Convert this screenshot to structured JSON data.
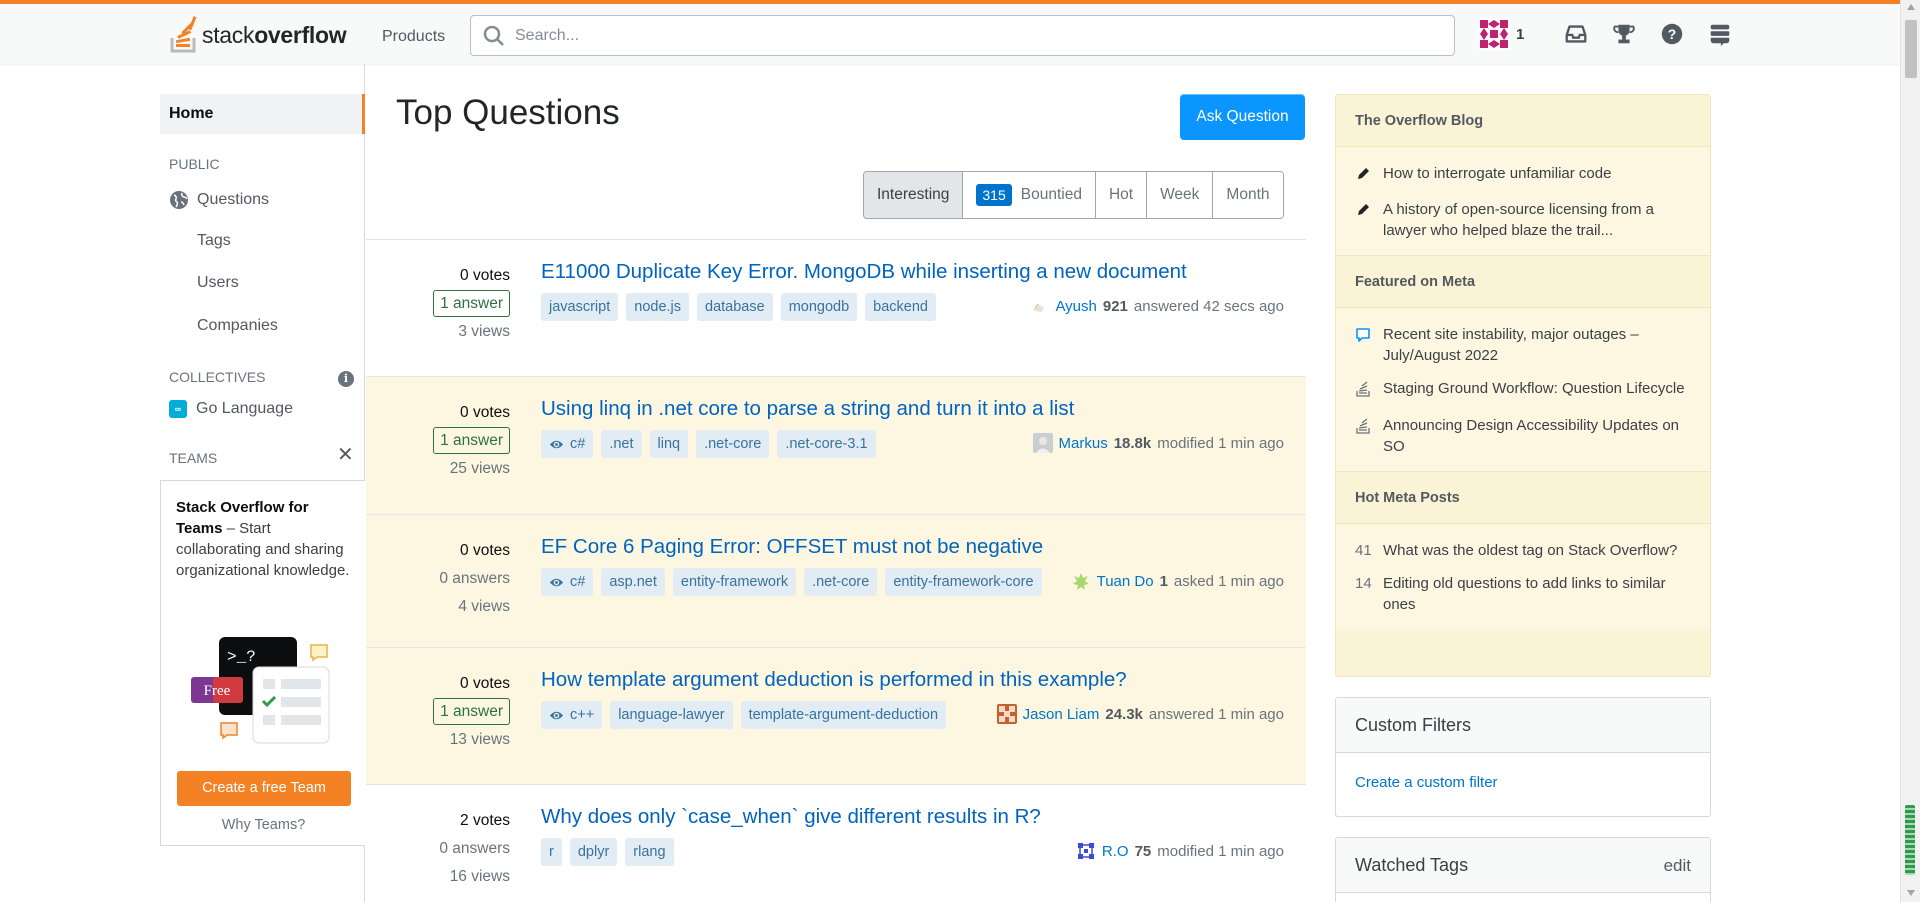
{
  "header": {
    "logo_text_light": "stack",
    "logo_text_bold": "overflow",
    "products_label": "Products",
    "search_placeholder": "Search...",
    "reputation": "1",
    "icons": [
      "inbox-icon",
      "achievements-icon",
      "help-icon",
      "site-switcher-icon"
    ]
  },
  "leftnav": {
    "home": "Home",
    "public_label": "PUBLIC",
    "questions": "Questions",
    "tags": "Tags",
    "users": "Users",
    "companies": "Companies",
    "collectives_label": "COLLECTIVES",
    "go_language": "Go Language",
    "teams_label": "TEAMS",
    "teams_title": "Stack Overflow for Teams",
    "teams_desc": " – Start collaborating and sharing organizational knowledge.",
    "teams_free_badge": "Free",
    "teams_terminal_text": ">_?",
    "create_team": "Create a free Team",
    "why_teams": "Why Teams?"
  },
  "main": {
    "title": "Top Questions",
    "ask_button": "Ask Question",
    "filters": {
      "interesting": "Interesting",
      "bounty_count": "315",
      "bountied": "Bountied",
      "hot": "Hot",
      "week": "Week",
      "month": "Month"
    },
    "questions": [
      {
        "votes": "0 votes",
        "answers": "1 answer",
        "views": "3 views",
        "title": "E11000 Duplicate Key Error. MongoDB while inserting a new document",
        "tags": [
          "javascript",
          "node.js",
          "database",
          "mongodb",
          "backend"
        ],
        "user": "Ayush",
        "rep": "921",
        "action": "answered 42 secs ago"
      },
      {
        "votes": "0 votes",
        "answers": "1 answer",
        "views": "25 views",
        "title": "Using linq in .net core to parse a string and turn it into a list",
        "tags": [
          "c#",
          ".net",
          "linq",
          ".net-core",
          ".net-core-3.1"
        ],
        "user": "Markus",
        "rep": "18.8k",
        "action": "modified 1 min ago"
      },
      {
        "votes": "0 votes",
        "answers": "0 answers",
        "views": "4 views",
        "title": "EF Core 6 Paging Error: OFFSET must not be negative",
        "tags": [
          "c#",
          "asp.net",
          "entity-framework",
          ".net-core",
          "entity-framework-core"
        ],
        "user": "Tuan Do",
        "rep": "1",
        "action": "asked 1 min ago"
      },
      {
        "votes": "0 votes",
        "answers": "1 answer",
        "views": "13 views",
        "title": "How template argument deduction is performed in this example?",
        "tags": [
          "c++",
          "language-lawyer",
          "template-argument-deduction"
        ],
        "user": "Jason Liam",
        "rep": "24.3k",
        "action": "answered 1 min ago"
      },
      {
        "votes": "2 votes",
        "answers": "0 answers",
        "views": "16 views",
        "title": "Why does only `case_when` give different results in R?",
        "tags": [
          "r",
          "dplyr",
          "rlang"
        ],
        "user": "R.O",
        "rep": "75",
        "action": "modified 1 min ago"
      }
    ]
  },
  "sidebar": {
    "blog_title": "The Overflow Blog",
    "blog_items": [
      "How to interrogate unfamiliar code",
      "A history of open-source licensing from a lawyer who helped blaze the trail..."
    ],
    "meta_title": "Featured on Meta",
    "meta_items": [
      "Recent site instability, major outages – July/August 2022",
      "Staging Ground Workflow: Question Lifecycle",
      "Announcing Design Accessibility Updates on SO"
    ],
    "hot_meta_title": "Hot Meta Posts",
    "hot_meta": [
      {
        "count": "41",
        "text": "What was the oldest tag on Stack Overflow?"
      },
      {
        "count": "14",
        "text": "Editing old questions to add links to similar ones"
      }
    ],
    "custom_filters_title": "Custom Filters",
    "create_filter": "Create a custom filter",
    "watched_tags_title": "Watched Tags",
    "watched_edit": "edit"
  },
  "colors": {
    "accent": "#f48225",
    "link": "#0074cc",
    "ask_button": "#0a95ff",
    "highlight_row": "#fdf7e2",
    "answered": "#2f6f44",
    "tag_bg": "#e1ecf4",
    "tag_text": "#39739d"
  }
}
